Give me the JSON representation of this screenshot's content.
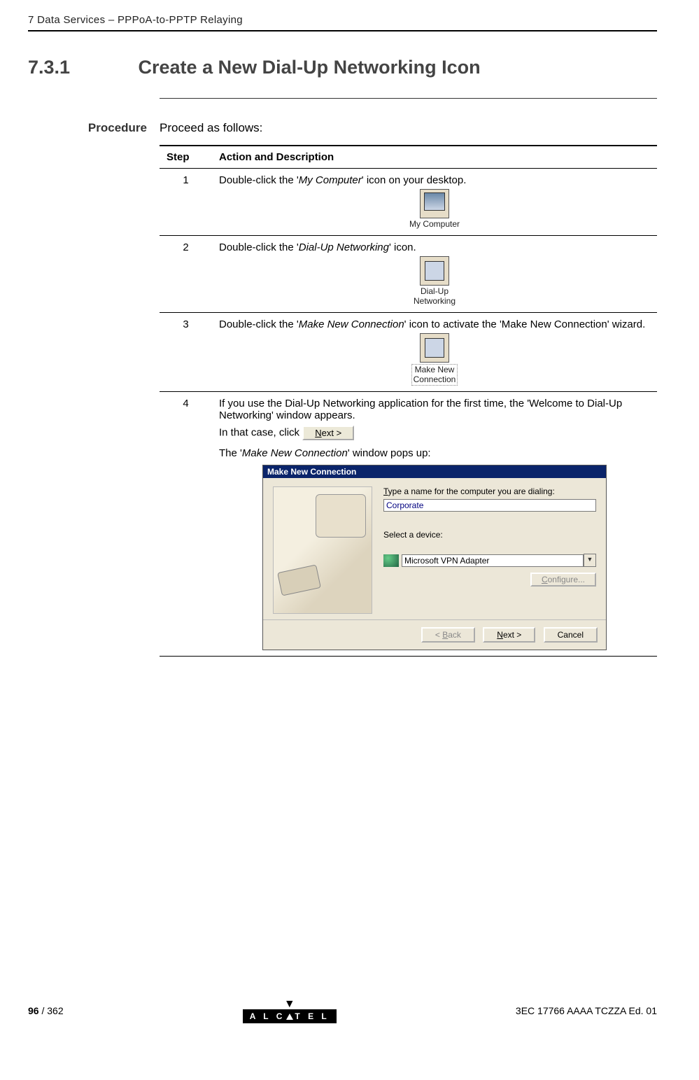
{
  "header": {
    "breadcrumb": "7   Data Services – PPPoA-to-PPTP Relaying"
  },
  "section": {
    "number": "7.3.1",
    "title": "Create a New Dial-Up Networking Icon"
  },
  "subheading": "Procedure",
  "intro": "Proceed as follows:",
  "table": {
    "col_step": "Step",
    "col_action": "Action and Description",
    "rows": [
      {
        "num": "1",
        "text_before": "Double-click the '",
        "italic": "My Computer",
        "text_after": "' icon on your desktop.",
        "icon_label": "My Computer"
      },
      {
        "num": "2",
        "text_before": "Double-click the '",
        "italic": "Dial-Up Networking",
        "text_after": "' icon.",
        "icon_label": "Dial-Up\nNetworking"
      },
      {
        "num": "3",
        "text_before": "Double-click the '",
        "italic": "Make New Connection",
        "text_after": "' icon to activate the 'Make New Connection' wizard.",
        "icon_label": "Make New\nConnection"
      }
    ],
    "row4": {
      "num": "4",
      "line1": "If you use the Dial-Up Networking application for the first time, the 'Welcome to Dial-Up Networking' window appears.",
      "line2_pre": "In that case, click ",
      "button_mnemonic": "N",
      "button_rest": "ext >",
      "line3_pre": "The '",
      "line3_italic": "Make New Connection",
      "line3_post": "' window pops up:"
    }
  },
  "dialog": {
    "title": "Make New Connection",
    "label_name": "Type a name for the computer you are dialing:",
    "input_value": "Corporate",
    "label_device": "Select a device:",
    "device_value": "Microsoft VPN Adapter",
    "btn_configure": "Configure...",
    "btn_back": "< Back",
    "btn_next": "Next >",
    "btn_cancel": "Cancel"
  },
  "footer": {
    "page_current": "96",
    "page_sep": " / ",
    "page_total": "362",
    "doc_id": "3EC 17766 AAAA TCZZA Ed. 01",
    "logo": "A L C   T E L"
  }
}
